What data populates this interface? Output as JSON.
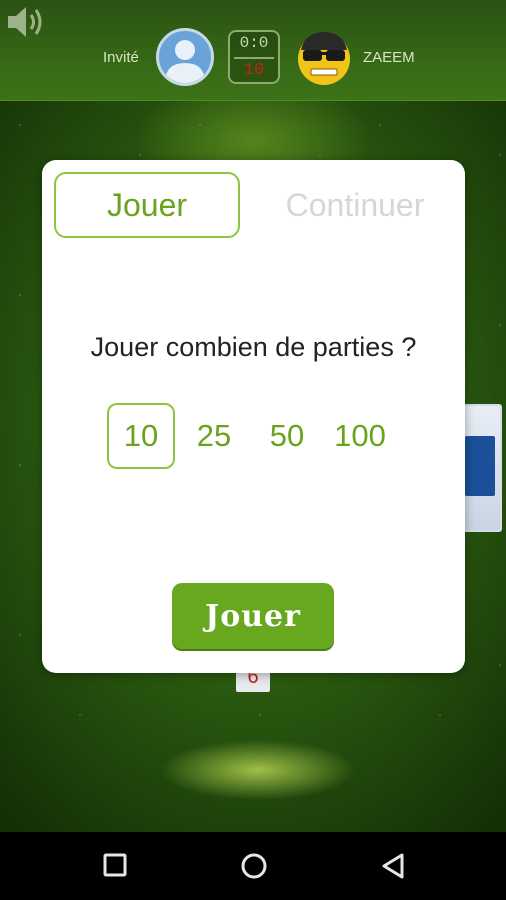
{
  "header": {
    "guest_name": "Invité",
    "opponent_name": "ZAEEM",
    "score": "0:0",
    "target": "10"
  },
  "dialog": {
    "tabs": [
      {
        "label": "Jouer",
        "active": true
      },
      {
        "label": "Continuer",
        "active": false
      }
    ],
    "question": "Jouer combien de parties ?",
    "options": [
      {
        "label": "10",
        "selected": true
      },
      {
        "label": "25",
        "selected": false
      },
      {
        "label": "50",
        "selected": false
      },
      {
        "label": "100",
        "selected": false
      }
    ],
    "play_button": "Jouer"
  },
  "board": {
    "small_card": "6"
  },
  "colors": {
    "accent": "#6aa31d",
    "button": "#67a81f",
    "score_target": "#c0251c"
  },
  "icons": {
    "sound": "speaker-icon",
    "guest": "user-icon",
    "opponent": "sunglasses-emoji-icon",
    "nav": [
      "square-recent-icon",
      "circle-home-icon",
      "triangle-back-icon"
    ]
  }
}
